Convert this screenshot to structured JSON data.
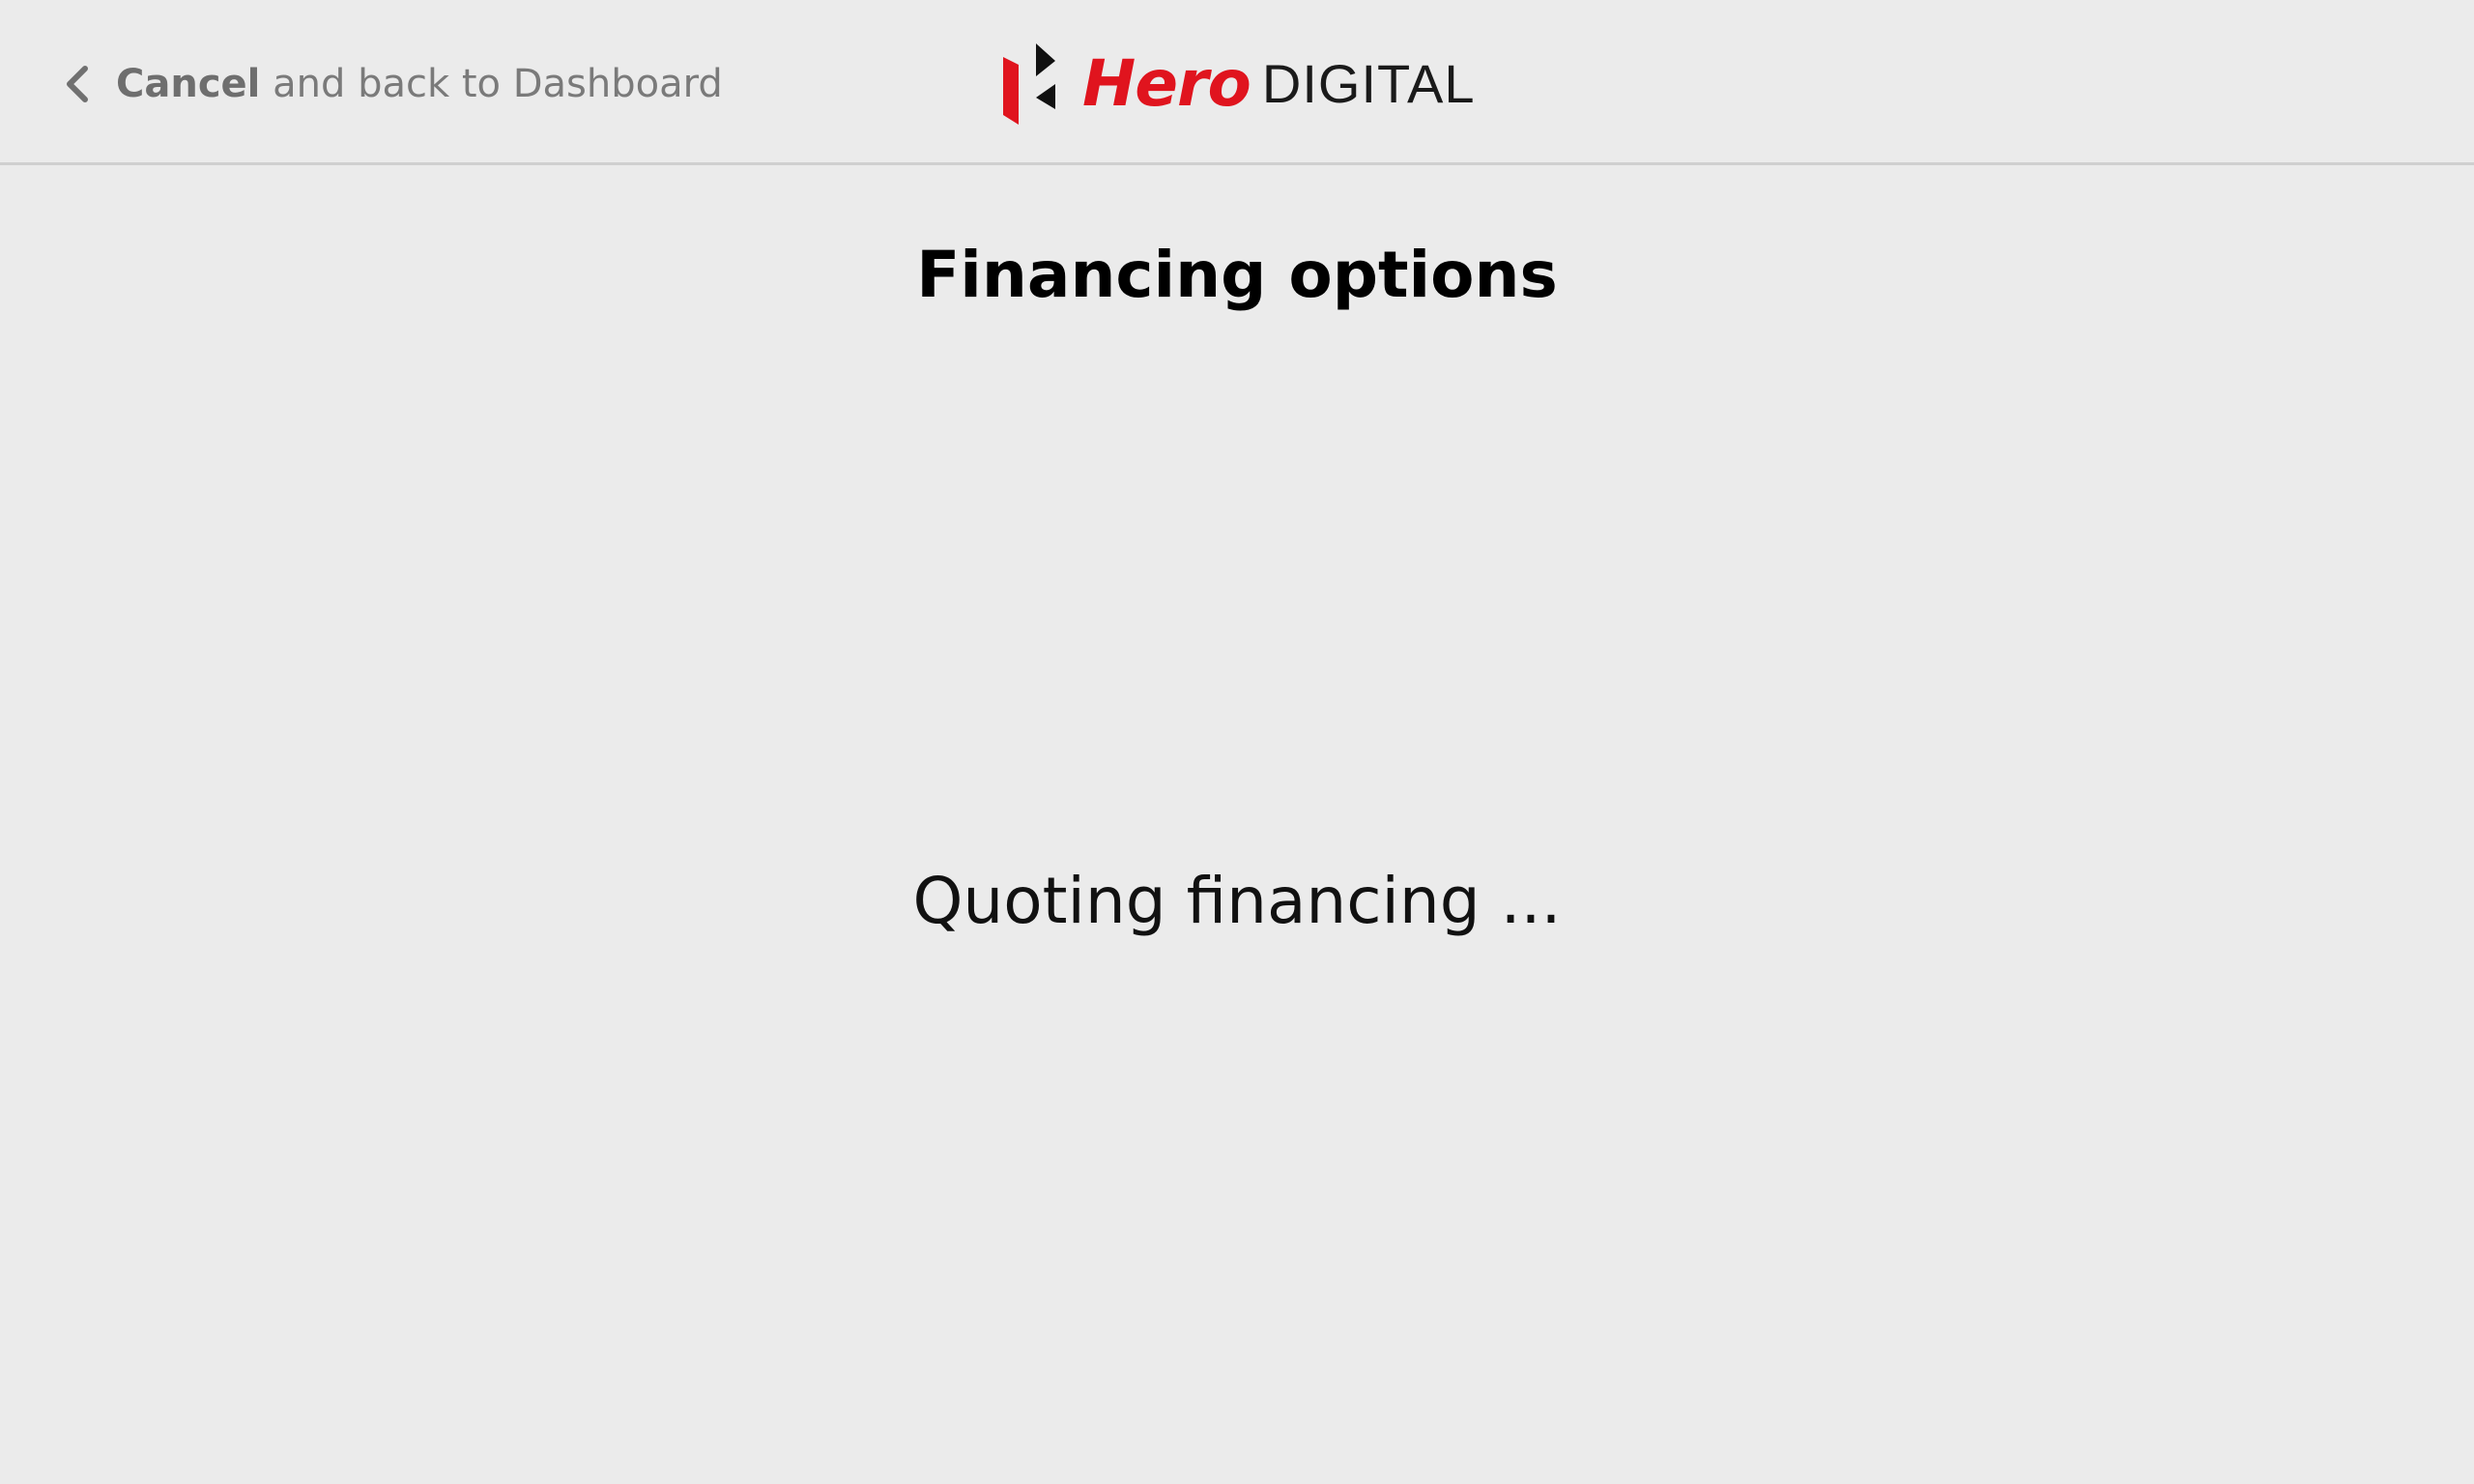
{
  "header": {
    "back_link": {
      "cancel_label": "Cancel",
      "rest_label": "and back to Dashboard"
    },
    "logo": {
      "brand_word": "Hero",
      "product_word": "DIGITAL",
      "brand_color": "#e0141e"
    }
  },
  "main": {
    "title": "Financing options",
    "status": "Quoting financing ..."
  },
  "icons": {
    "back": "chevron-left-icon",
    "logo_mark": "hero-logo-mark-icon"
  },
  "colors": {
    "background": "#ebebeb",
    "divider": "#cfcfcf",
    "muted_text": "#707070"
  }
}
